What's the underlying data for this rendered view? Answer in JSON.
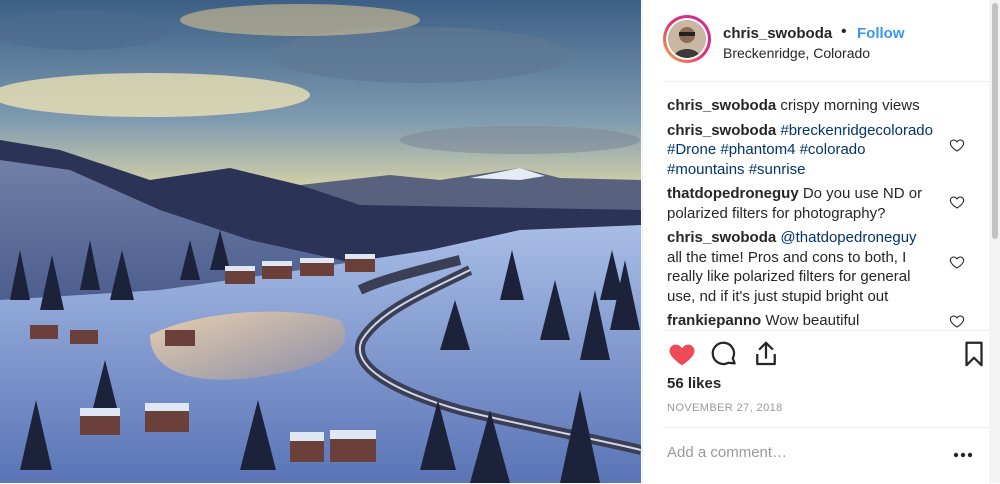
{
  "post": {
    "username": "chris_swoboda",
    "separator": "•",
    "follow_label": "Follow",
    "location": "Breckenridge, Colorado",
    "likes": "56 likes",
    "date": "NOVEMBER 27, 2018",
    "comment_placeholder": "Add a comment…"
  },
  "comments": [
    {
      "user": "chris_swoboda",
      "text": "crispy morning views"
    },
    {
      "user": "chris_swoboda",
      "tags": "#breckenridgecolorado #Drone #phantom4 #colorado #mountains #sunrise"
    },
    {
      "user": "thatdopedroneguy",
      "text": "Do you use ND or polarized filters for photography?"
    },
    {
      "user": "chris_swoboda",
      "mention": "@thatdopedroneguy",
      "text": "all the time! Pros and cons to both, I really like polarized filters for general use, nd if it's just stupid bright out"
    },
    {
      "user": "frankiepanno",
      "text": "Wow beautiful"
    }
  ],
  "icons": {
    "like": "heart-filled-icon",
    "comment": "speech-bubble-icon",
    "share": "share-icon",
    "save": "bookmark-icon",
    "comment_like": "heart-outline-icon",
    "more": "more-options-icon"
  },
  "colors": {
    "like_active": "#ed4956",
    "follow": "#3897f0",
    "hashtag": "#003569",
    "muted": "#999999"
  }
}
